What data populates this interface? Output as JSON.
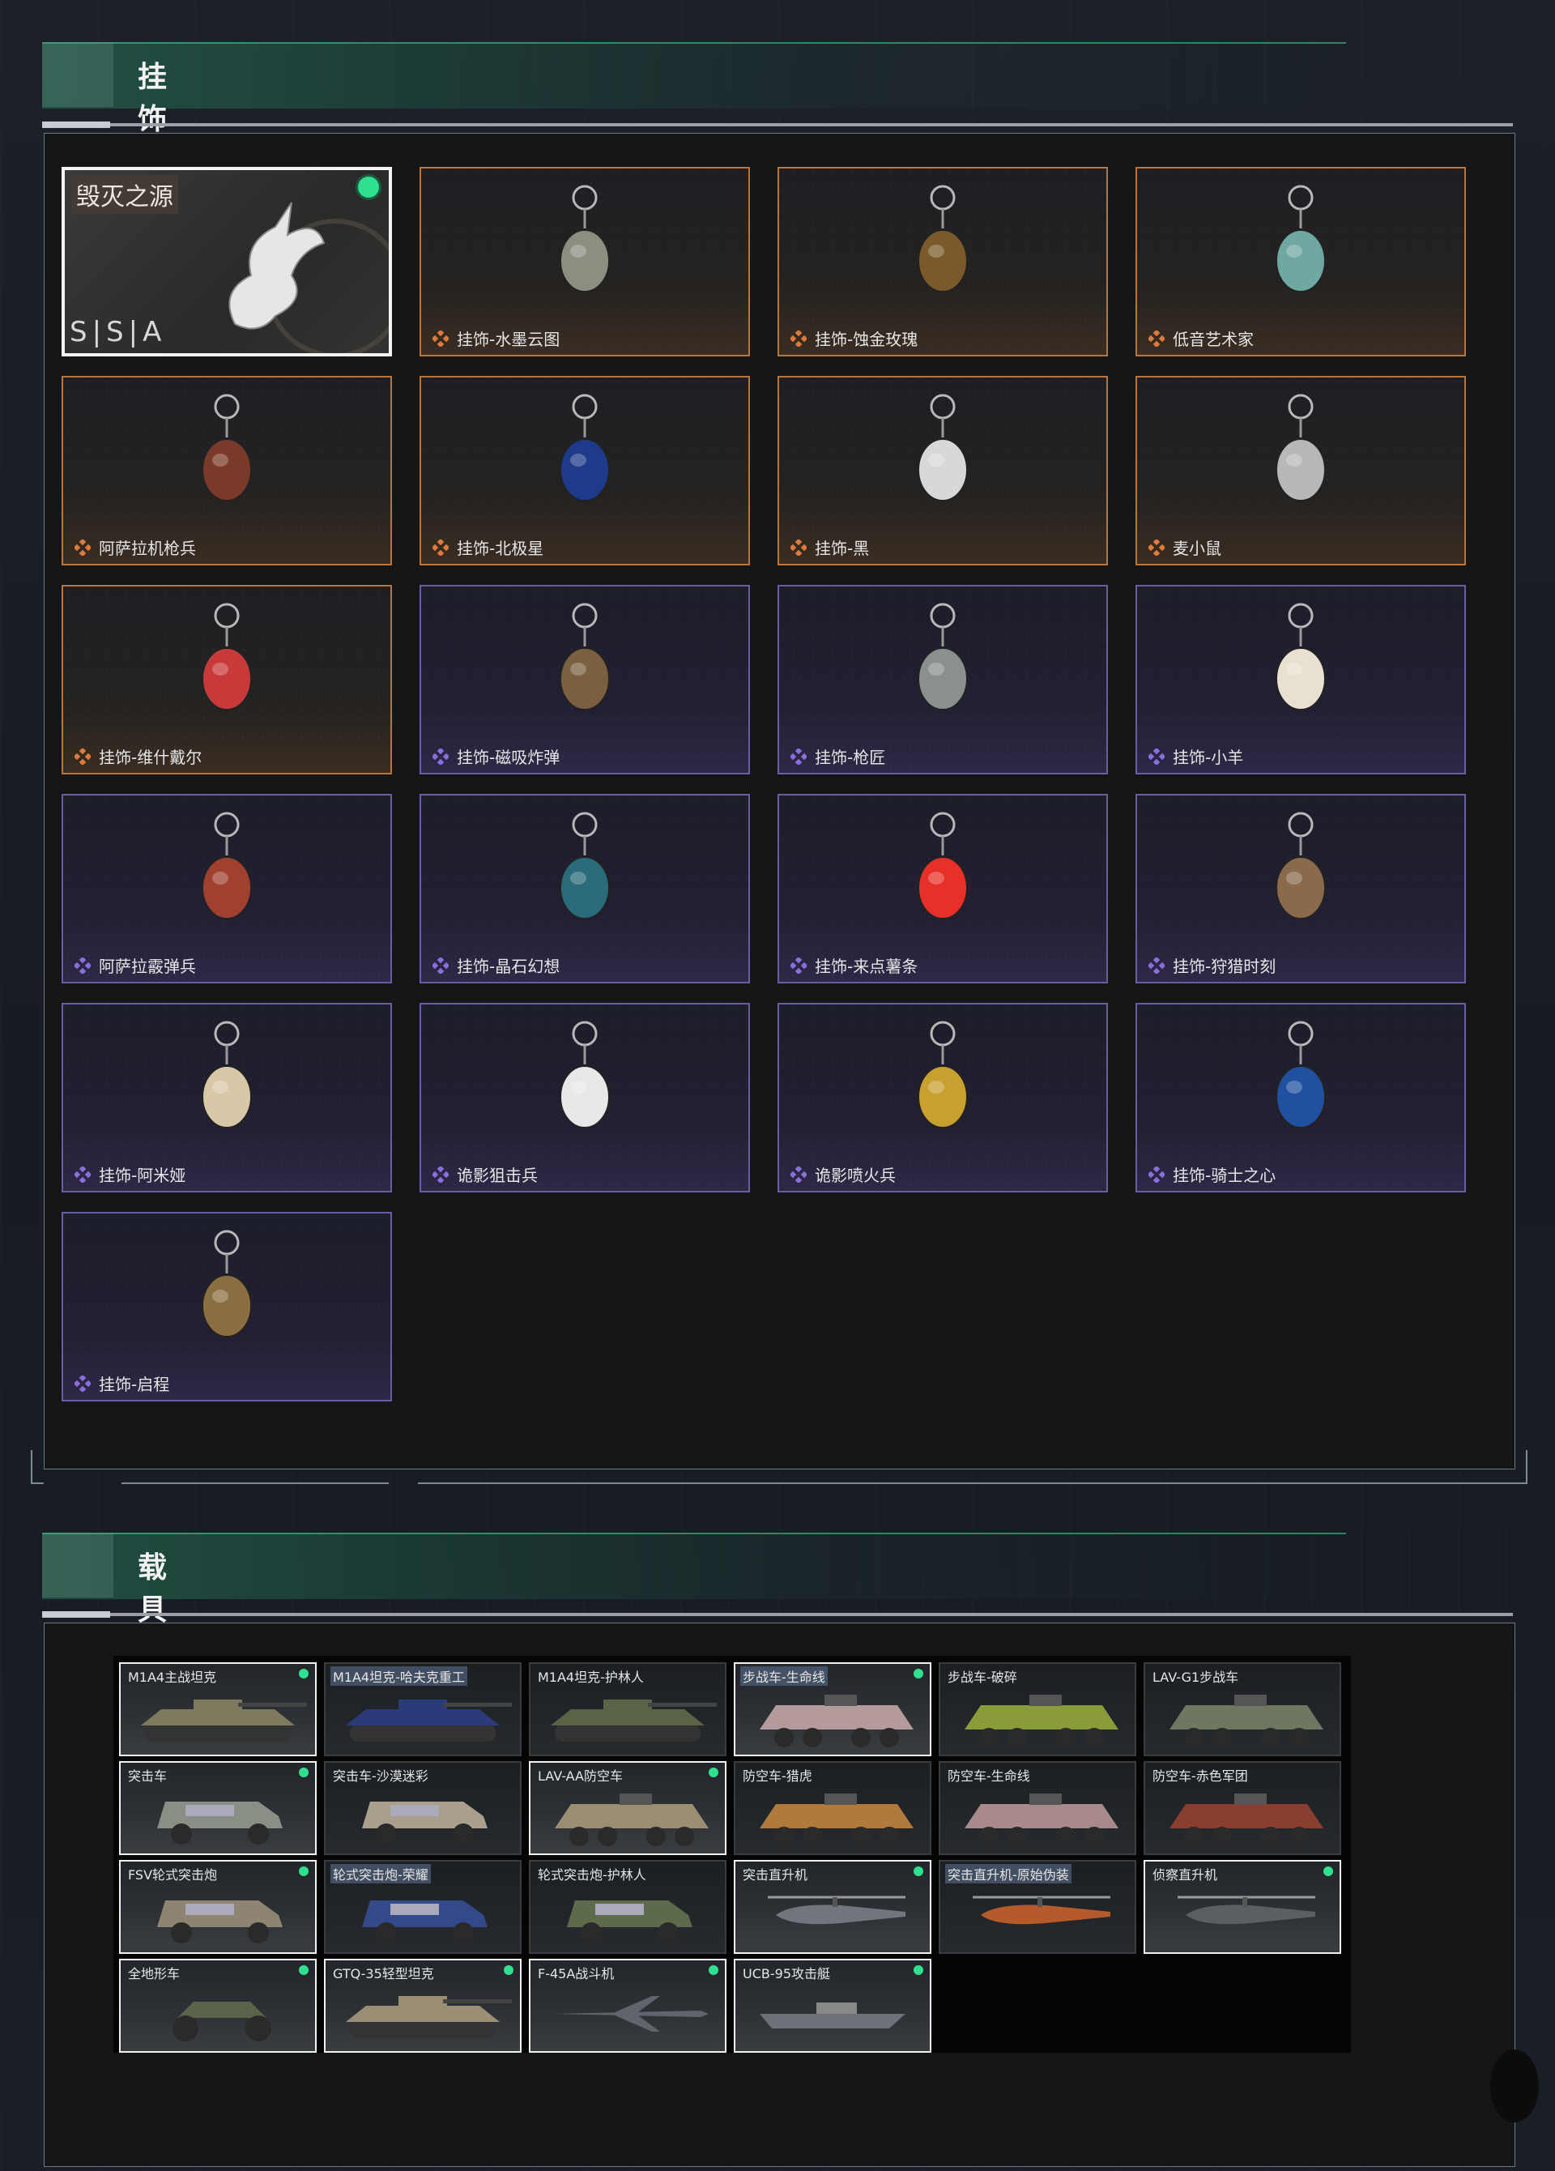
{
  "sections": {
    "ornaments_title": "挂饰",
    "vehicles_title": "载具"
  },
  "featured": {
    "title": "毁灭之源",
    "logo": "S|S|A"
  },
  "ornaments": [
    {
      "label": "挂饰-水墨云图",
      "rarity": "orange"
    },
    {
      "label": "挂饰-蚀金玫瑰",
      "rarity": "orange"
    },
    {
      "label": "低音艺术家",
      "rarity": "orange"
    },
    {
      "label": "阿萨拉机枪兵",
      "rarity": "orange"
    },
    {
      "label": "挂饰-北极星",
      "rarity": "orange"
    },
    {
      "label": "挂饰-黑",
      "rarity": "orange"
    },
    {
      "label": "麦小鼠",
      "rarity": "orange"
    },
    {
      "label": "挂饰-维什戴尔",
      "rarity": "orange"
    },
    {
      "label": "挂饰-磁吸炸弹",
      "rarity": "purple"
    },
    {
      "label": "挂饰-枪匠",
      "rarity": "purple"
    },
    {
      "label": "挂饰-小羊",
      "rarity": "purple"
    },
    {
      "label": "阿萨拉霰弹兵",
      "rarity": "purple"
    },
    {
      "label": "挂饰-晶石幻想",
      "rarity": "purple"
    },
    {
      "label": "挂饰-来点薯条",
      "rarity": "purple"
    },
    {
      "label": "挂饰-狩猎时刻",
      "rarity": "purple"
    },
    {
      "label": "挂饰-阿米娅",
      "rarity": "purple"
    },
    {
      "label": "诡影狙击兵",
      "rarity": "purple"
    },
    {
      "label": "诡影喷火兵",
      "rarity": "purple"
    },
    {
      "label": "挂饰-骑士之心",
      "rarity": "purple"
    },
    {
      "label": "挂饰-启程",
      "rarity": "purple"
    }
  ],
  "vehicles": [
    {
      "label": "M1A4主战坦克",
      "dot": true,
      "style": "white",
      "kind": "tank",
      "color": "#7d7a5e"
    },
    {
      "label": "M1A4坦克-哈夫克重工",
      "dot": false,
      "style": "dark",
      "kind": "tank",
      "color": "#2b3a78",
      "hl": true
    },
    {
      "label": "M1A4坦克-护林人",
      "dot": false,
      "style": "dark",
      "kind": "tank",
      "color": "#5a6346"
    },
    {
      "label": "步战车-生命线",
      "dot": true,
      "style": "white",
      "kind": "ifv",
      "color": "#b49a9a",
      "hl": true
    },
    {
      "label": "步战车-破碎",
      "dot": false,
      "style": "dark",
      "kind": "ifv",
      "color": "#8a9b3a"
    },
    {
      "label": "LAV-G1步战车",
      "dot": false,
      "style": "dark",
      "kind": "ifv",
      "color": "#6e7760"
    },
    {
      "label": "突击车",
      "dot": true,
      "style": "white",
      "kind": "jeep",
      "color": "#8a8f86"
    },
    {
      "label": "突击车-沙漠迷彩",
      "dot": false,
      "style": "dark",
      "kind": "jeep",
      "color": "#a99f8c"
    },
    {
      "label": "LAV-AA防空车",
      "dot": true,
      "style": "white",
      "kind": "ifv",
      "color": "#9c8e72"
    },
    {
      "label": "防空车-猎虎",
      "dot": false,
      "style": "dark",
      "kind": "ifv",
      "color": "#b07a3c"
    },
    {
      "label": "防空车-生命线",
      "dot": false,
      "style": "dark",
      "kind": "ifv",
      "color": "#a88a8a"
    },
    {
      "label": "防空车-赤色军团",
      "dot": false,
      "style": "dark",
      "kind": "ifv",
      "color": "#8a3e30"
    },
    {
      "label": "FSV轮式突击炮",
      "dot": true,
      "style": "white",
      "kind": "jeep",
      "color": "#8d8472"
    },
    {
      "label": "轮式突击炮-荣耀",
      "dot": false,
      "style": "dark",
      "kind": "jeep",
      "color": "#33498a",
      "hl": true
    },
    {
      "label": "轮式突击炮-护林人",
      "dot": false,
      "style": "dark",
      "kind": "jeep",
      "color": "#5e6a4c"
    },
    {
      "label": "突击直升机",
      "dot": true,
      "style": "white",
      "kind": "heli",
      "color": "#70767c"
    },
    {
      "label": "突击直升机-原始伪装",
      "dot": false,
      "style": "dark",
      "kind": "heli",
      "color": "#b55a2a",
      "hl": true
    },
    {
      "label": "侦察直升机",
      "dot": true,
      "style": "white",
      "kind": "heli",
      "color": "#5a5f64"
    },
    {
      "label": "全地形车",
      "dot": true,
      "style": "white",
      "kind": "atv",
      "color": "#5b6448"
    },
    {
      "label": "GTQ-35轻型坦克",
      "dot": true,
      "style": "white",
      "kind": "tank",
      "color": "#9a8f74"
    },
    {
      "label": "F-45A战斗机",
      "dot": true,
      "style": "white",
      "kind": "jet",
      "color": "#5f656b"
    },
    {
      "label": "UCB-95攻击艇",
      "dot": true,
      "style": "white",
      "kind": "boat",
      "color": "#6c7278"
    }
  ],
  "colors": {
    "orange_rarity": "#e07a3a",
    "purple_rarity": "#8a6ee0",
    "green_dot": "#2fe08f"
  }
}
